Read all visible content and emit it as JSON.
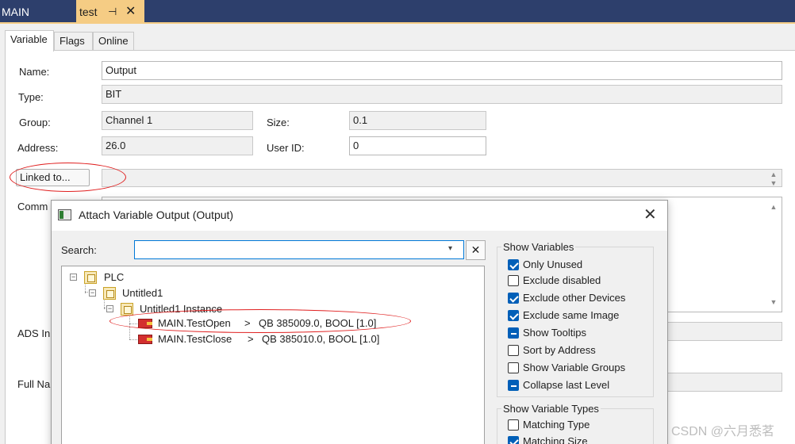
{
  "doc_tabs": {
    "main": "MAIN",
    "active": "test",
    "pin": "⊣",
    "close": "✕"
  },
  "prop_tabs": [
    "Variable",
    "Flags",
    "Online"
  ],
  "fields": {
    "name_label": "Name:",
    "name_value": "Output",
    "type_label": "Type:",
    "type_value": "BIT",
    "group_label": "Group:",
    "group_value": "Channel 1",
    "size_label": "Size:",
    "size_value": "0.1",
    "address_label": "Address:",
    "address_value": "26.0",
    "userid_label": "User ID:",
    "userid_value": "0",
    "linked_button": "Linked to...",
    "comment_label": "Comm",
    "ads_label": "ADS In",
    "fullname_label": "Full Na"
  },
  "dialog": {
    "title": "Attach Variable Output (Output)",
    "close": "✕",
    "search_label": "Search:",
    "search_value": "",
    "search_drop": "▾",
    "search_clear": "✕",
    "tree": {
      "plc": "PLC",
      "project": "Untitled1",
      "instance": "Untitled1 Instance",
      "items": [
        {
          "name": "MAIN.TestOpen",
          "sep": ">",
          "target": "QB 385009.0, BOOL [1.0]"
        },
        {
          "name": "MAIN.TestClose",
          "sep": ">",
          "target": "QB 385010.0, BOOL [1.0]"
        }
      ]
    },
    "show_variables": {
      "title": "Show Variables",
      "options": [
        {
          "label": "Only Unused",
          "state": "checked"
        },
        {
          "label": "Exclude disabled",
          "state": "unchecked"
        },
        {
          "label": "Exclude other Devices",
          "state": "checked"
        },
        {
          "label": "Exclude same Image",
          "state": "checked"
        },
        {
          "label": "Show Tooltips",
          "state": "indeterminate"
        },
        {
          "label": "Sort by Address",
          "state": "unchecked"
        },
        {
          "label": "Show Variable Groups",
          "state": "unchecked"
        },
        {
          "label": "Collapse last Level",
          "state": "indeterminate"
        }
      ]
    },
    "show_variable_types": {
      "title": "Show Variable Types",
      "options": [
        {
          "label": "Matching Type",
          "state": "unchecked"
        },
        {
          "label": "Matching Size",
          "state": "checked"
        }
      ]
    }
  },
  "watermark": "CSDN @六月悉茗",
  "colors": {
    "tab_strip": "#2d3f6c",
    "active_tab": "#f5cc84",
    "annotation": "#e02020",
    "checkbox": "#005fb8"
  }
}
